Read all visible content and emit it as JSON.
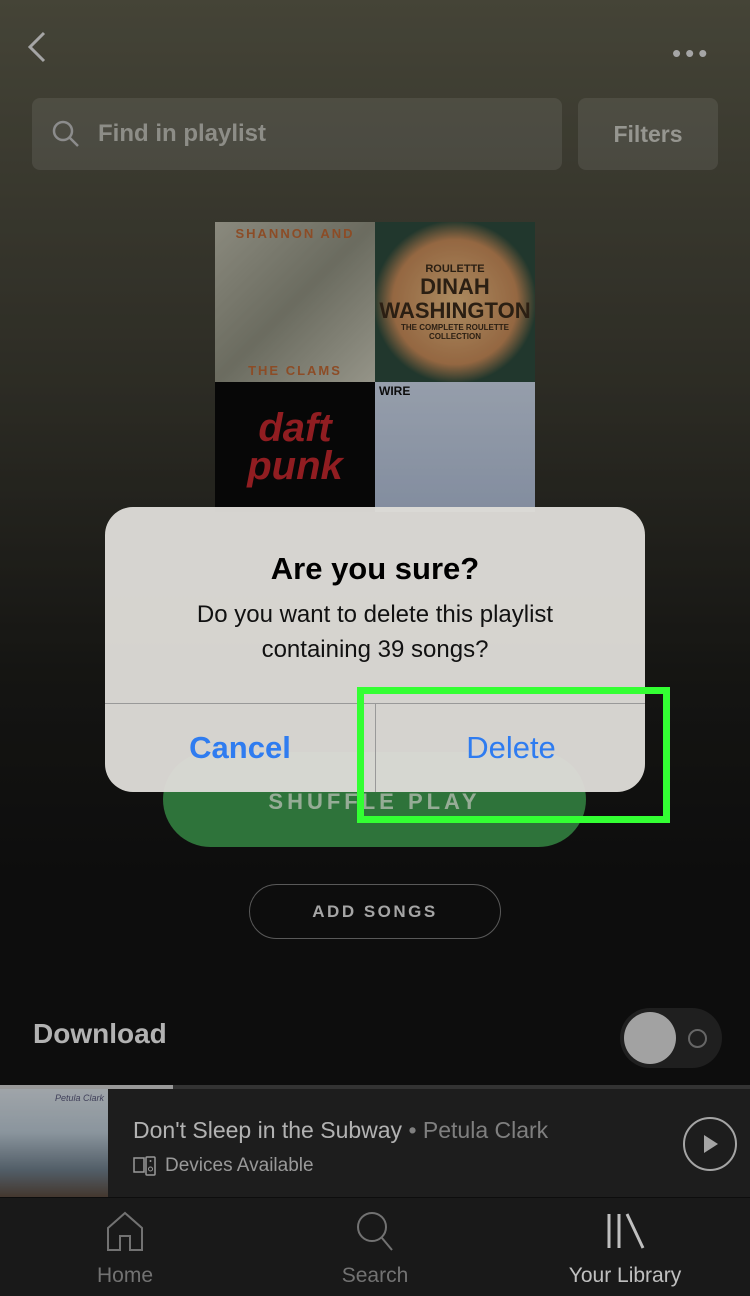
{
  "header": {
    "back_icon": "chevron-left-icon",
    "more_icon": "ellipsis-icon",
    "more_label": "•••"
  },
  "search": {
    "placeholder": "Find in playlist",
    "icon": "search-icon"
  },
  "filters_label": "Filters",
  "album_art": [
    {
      "line1": "SHANNON AND",
      "line2": "THE CLAMS"
    },
    {
      "line1": "ROULETTE",
      "line2": "DINAH",
      "line3": "WASHINGTON",
      "line4": "THE COMPLETE ROULETTE COLLECTION"
    },
    {
      "line1": "daft",
      "line2": "punk"
    },
    {
      "line1": "WIRE"
    }
  ],
  "shuffle_label": "SHUFFLE PLAY",
  "add_songs_label": "ADD SONGS",
  "download": {
    "label": "Download",
    "enabled": false
  },
  "dialog": {
    "title": "Are you sure?",
    "message": "Do you want to delete this playlist containing 39 songs?",
    "cancel": "Cancel",
    "delete": "Delete",
    "button_color": "#2f7cf0"
  },
  "highlight_color": "#33ff33",
  "now_playing": {
    "title": "Don't Sleep in the Subway",
    "separator": " • ",
    "artist": "Petula Clark",
    "devices": "Devices Available",
    "thumb_text": "Petula Clark",
    "progress_percent": 23
  },
  "nav": [
    {
      "label": "Home",
      "icon": "home-icon"
    },
    {
      "label": "Search",
      "icon": "search-icon"
    },
    {
      "label": "Your Library",
      "icon": "library-icon",
      "active": true
    }
  ],
  "accent": "#1db954"
}
